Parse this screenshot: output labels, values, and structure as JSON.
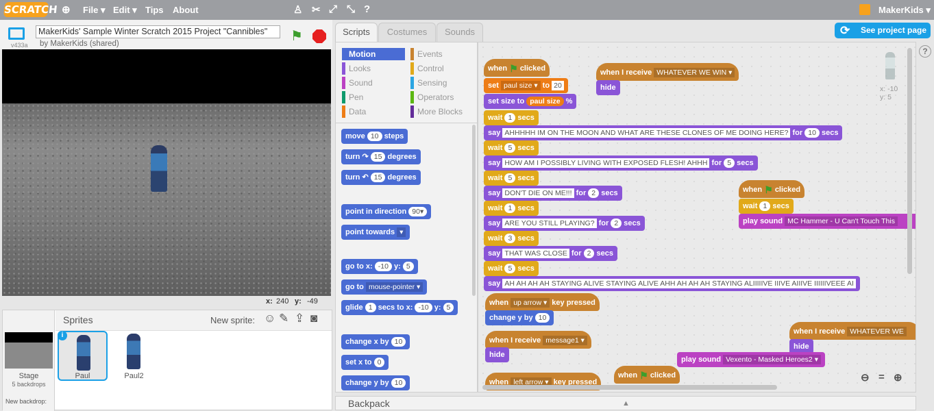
{
  "menubar": {
    "logo": "SCRATCH",
    "file": "File ▾",
    "edit": "Edit ▾",
    "tips": "Tips",
    "about": "About",
    "user": "MakerKids ▾"
  },
  "stage": {
    "version": "v433a",
    "title": "MakerKids' Sample Winter Scratch 2015 Project \"Cannibles\"",
    "byline": "by MakerKids (shared)",
    "x_label": "x:",
    "x_value": "240",
    "y_label": "y:",
    "y_value": "-49"
  },
  "sprites": {
    "header": "Sprites",
    "new_sprite": "New sprite:",
    "stage_label": "Stage",
    "stage_backdrops": "5 backdrops",
    "new_backdrop": "New backdrop:",
    "items": [
      {
        "name": "Paul"
      },
      {
        "name": "Paul2"
      }
    ]
  },
  "tabs": [
    "Scripts",
    "Costumes",
    "Sounds"
  ],
  "see_project": "See project page",
  "categories": [
    {
      "label": "Motion",
      "color": "#4a6cd4"
    },
    {
      "label": "Looks",
      "color": "#8a55d7"
    },
    {
      "label": "Sound",
      "color": "#bb42c3"
    },
    {
      "label": "Pen",
      "color": "#0e9a6c"
    },
    {
      "label": "Data",
      "color": "#ee7d16"
    },
    {
      "label": "Events",
      "color": "#c88330"
    },
    {
      "label": "Control",
      "color": "#e1a91a"
    },
    {
      "label": "Sensing",
      "color": "#2ca5e2"
    },
    {
      "label": "Operators",
      "color": "#5cb712"
    },
    {
      "label": "More Blocks",
      "color": "#632d99"
    }
  ],
  "palette": {
    "move": "move",
    "steps_val": "10",
    "steps": "steps",
    "turn": "turn",
    "deg_val": "15",
    "degrees": "degrees",
    "point_dir": "point in direction",
    "dir_val": "90▾",
    "point_towards": "point towards",
    "goto_xy": "go to x:",
    "goto_x": "-10",
    "goto_y_lbl": "y:",
    "goto_y": "5",
    "goto": "go to",
    "goto_target": "mouse-pointer ▾",
    "glide": "glide",
    "glide_secs": "1",
    "glide_secs_lbl": "secs to x:",
    "glide_x": "-10",
    "glide_y_lbl": "y:",
    "glide_y": "5",
    "change_x": "change x by",
    "change_x_val": "10",
    "set_x": "set x to",
    "set_x_val": "0",
    "change_y": "change y by",
    "change_y_val": "10"
  },
  "scripts": {
    "when": "when",
    "clicked": "clicked",
    "wait": "wait",
    "secs": "secs",
    "say": "say",
    "for": "for",
    "set": "set",
    "to": "to",
    "set_var": "paul size ▾",
    "set_val": "20",
    "set_size": "set size to",
    "size_var": "paul size",
    "pct": "%",
    "w1": "1",
    "w5": "5",
    "w3": "3",
    "say1": "AHHHHH IM ON THE MOON AND WHAT ARE THESE CLONES OF ME DOING HERE?",
    "say1_t": "10",
    "say2": "HOW AM I POSSIBLY LIVING WITH EXPOSED FLESH! AHHH",
    "say2_t": "5",
    "say3": "DON'T DIE ON ME!!!",
    "say3_t": "2",
    "say4": "ARE YOU STILL PLAYING?",
    "say4_t": "2",
    "say5": "THAT WAS CLOSE",
    "say5_t": "2",
    "say6": "AH AH AH AH STAYING ALIVE STAYING ALIVE AHH AH AH AH STAYING ALIIIIIVE IIIVE AIIIVE IIIIIIVEEE AI",
    "receive": "when I receive",
    "rcv1": "WHATEVER WE WIN ▾",
    "rcv2": "message1 ▾",
    "rcv3": "WHATEVER WE",
    "hide": "hide",
    "key_when": "when",
    "key1": "up arrow ▾",
    "key2": "left arrow ▾",
    "key_pressed": "key pressed",
    "change_y": "change y by",
    "change_y_val": "10",
    "play_sound": "play sound",
    "sound1": "MC Hammer - U Can't Touch This",
    "sound2": "Vexento - Masked Heroes2 ▾",
    "sprite_x": "x: -10",
    "sprite_y": "y: 5"
  },
  "backpack": "Backpack"
}
